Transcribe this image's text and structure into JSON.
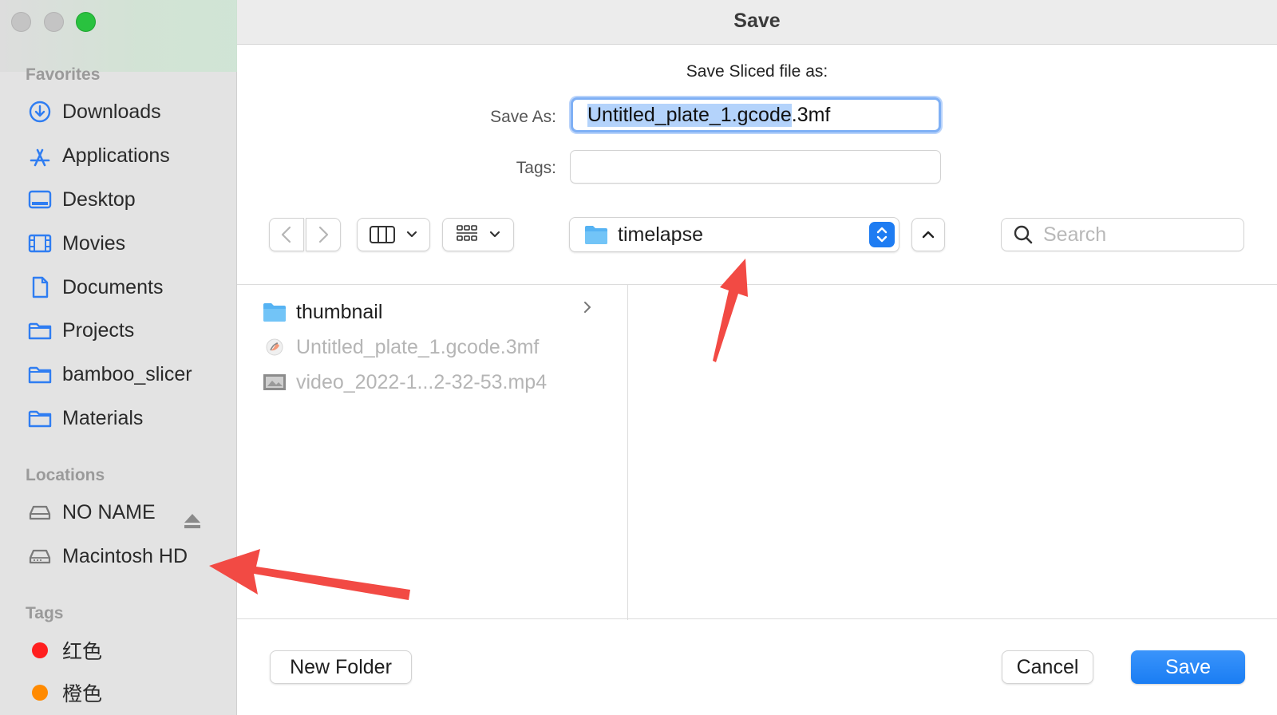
{
  "window": {
    "title": "Save"
  },
  "sidebar": {
    "favorites_title": "Favorites",
    "favorites": [
      {
        "label": "Downloads",
        "icon": "downloads-icon"
      },
      {
        "label": "Applications",
        "icon": "applications-icon"
      },
      {
        "label": "Desktop",
        "icon": "desktop-icon"
      },
      {
        "label": "Movies",
        "icon": "movies-icon"
      },
      {
        "label": "Documents",
        "icon": "document-icon"
      },
      {
        "label": "Projects",
        "icon": "folder-icon"
      },
      {
        "label": "bamboo_slicer",
        "icon": "folder-icon"
      },
      {
        "label": "Materials",
        "icon": "folder-icon"
      }
    ],
    "locations_title": "Locations",
    "locations": [
      {
        "label": "NO NAME",
        "icon": "drive-icon",
        "eject": true
      },
      {
        "label": "Macintosh HD",
        "icon": "drive-icon"
      }
    ],
    "tags_title": "Tags",
    "tags": [
      {
        "label": "红色",
        "color": "#ff1f1f"
      },
      {
        "label": "橙色",
        "color": "#ff8a00"
      }
    ]
  },
  "dialog": {
    "prompt": "Save Sliced file as:",
    "save_as_label": "Save As:",
    "save_as_selected": "Untitled_plate_1.gcode",
    "save_as_rest": ".3mf",
    "tags_label": "Tags:",
    "location": "timelapse",
    "search_placeholder": "Search"
  },
  "files": [
    {
      "name": "thumbnail",
      "type": "folder",
      "dim": false
    },
    {
      "name": "Untitled_plate_1.gcode.3mf",
      "type": "3mf",
      "dim": true
    },
    {
      "name": "video_2022-1...2-32-53.mp4",
      "type": "video",
      "dim": true
    }
  ],
  "footer": {
    "new_folder_label": "New Folder",
    "cancel_label": "Cancel",
    "save_label": "Save"
  },
  "colors": {
    "accent": "#1e7cf2",
    "annotation_arrow": "#f24a44"
  }
}
